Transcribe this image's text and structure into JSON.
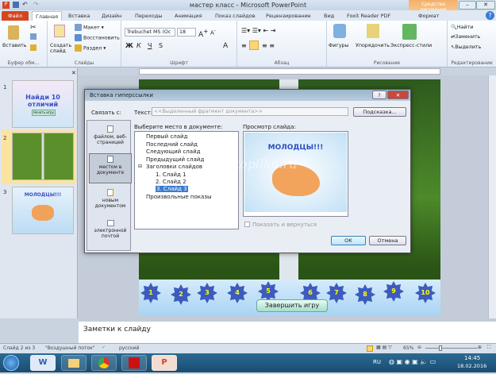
{
  "window": {
    "title": "мастер класс - Microsoft PowerPoint",
    "context_tab_group": "Средства рисования",
    "min": "–",
    "max": "□",
    "close": "✕"
  },
  "tabs": [
    "Файл",
    "Главная",
    "Вставка",
    "Дизайн",
    "Переходы",
    "Анимация",
    "Показ слайдов",
    "Рецензирование",
    "Вид",
    "Foxit Reader PDF",
    "Формат"
  ],
  "ribbon": {
    "clipboard": {
      "label": "Буфер обм...",
      "paste": "Вставить"
    },
    "slides": {
      "label": "Слайды",
      "create": "Создать слайд",
      "layout": "Макет",
      "reset": "Восстановить",
      "section": "Раздел"
    },
    "font": {
      "label": "Шрифт",
      "family": "Trebuchet MS (Ос",
      "size": "18",
      "bold": "Ж",
      "italic": "К",
      "underline": "Ч",
      "strike": "S"
    },
    "paragraph": {
      "label": "Абзац"
    },
    "drawing": {
      "label": "Рисование",
      "shapes": "Фигуры",
      "arrange": "Упорядочить",
      "quick_styles": "Экспресс-стили"
    },
    "editing": {
      "label": "Редактирование",
      "find": "Найти",
      "replace": "Заменить",
      "select": "Выделить"
    }
  },
  "thumbnails": [
    {
      "num": "1",
      "title": "Найди 10 отличий",
      "button": "Начать игру"
    },
    {
      "num": "2"
    },
    {
      "num": "3",
      "title": "МОЛОДЦЫ!!!"
    }
  ],
  "slide": {
    "numbers": [
      "1",
      "2",
      "3",
      "4",
      "5",
      "6",
      "7",
      "8",
      "9",
      "10"
    ],
    "finish_button": "Завершить игру"
  },
  "dialog": {
    "title": "Вставка гиперссылки",
    "help": "?",
    "close": "✕",
    "link_to": "Связать с:",
    "text_label": "Текст:",
    "text_value": "<<Выделенный фрагмент документа>>",
    "tooltip_btn": "Подсказка...",
    "link_options": [
      "файлом, веб-страницей",
      "местом в документе",
      "новым документом",
      "электронной почтой"
    ],
    "place_label": "Выберите место в документе:",
    "tree": [
      "Первый слайд",
      "Последний слайд",
      "Следующий слайд",
      "Предыдущий слайд",
      "Заголовки слайдов",
      "1. Слайд 1",
      "2. Слайд 2",
      "3. Слайд 3",
      "Произвольные показы"
    ],
    "preview_label": "Просмотр слайда:",
    "preview_title": "МОЛОДЦЫ!!!",
    "watermark": "ped-kopilka.ru",
    "show_return": "Показать и вернуться",
    "ok": "ОК",
    "cancel": "Отмена"
  },
  "notes": {
    "placeholder": "Заметки к слайду"
  },
  "status": {
    "slide": "Слайд 2 из 3",
    "theme": "\"Воздушный поток\"",
    "lang": "русский",
    "zoom": "65%"
  },
  "taskbar": {
    "apps": [
      "W",
      "",
      "",
      "",
      "P"
    ],
    "lang": "RU",
    "time": "14:45",
    "date": "18.02.2016"
  }
}
